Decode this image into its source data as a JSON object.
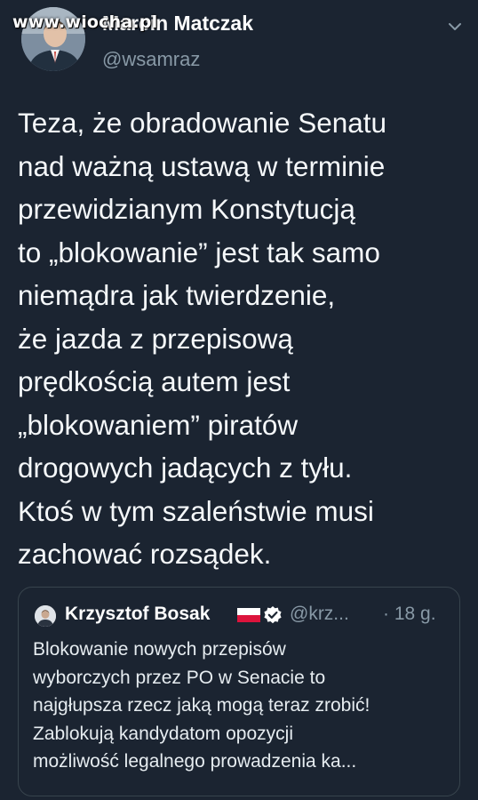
{
  "watermark": "www.wiocha.pl",
  "author": {
    "name": "Marcin Matczak",
    "handle": "@wsamraz"
  },
  "tweet": {
    "lines": [
      "Teza, że obradowanie Senatu",
      "nad ważną ustawą w terminie",
      "przewidzianym Konstytucją",
      "to „blokowanie” jest tak samo",
      "niemądra jak twierdzenie,",
      "że jazda z przepisową",
      "prędkością autem jest",
      "„blokowaniem” piratów",
      "drogowych jadących z tyłu.",
      "Ktoś w tym szaleństwie musi",
      "zachować rozsądek."
    ]
  },
  "quote": {
    "name": "Krzysztof Bosak",
    "handle": "@krz...",
    "time": "· 18 g.",
    "lines": [
      "Blokowanie nowych przepisów",
      "wyborczych przez PO w Senacie to",
      "najgłupsza rzecz jaką mogą teraz zrobić!",
      "Zablokują kandydatom opozycji",
      "możliwość legalnego prowadzenia ka..."
    ]
  },
  "icons": {
    "chevron": "chevron-down-icon",
    "verified": "verified-badge-icon",
    "flag": "poland-flag-icon"
  },
  "colors": {
    "background": "#1b2431",
    "text": "#f5f8fa",
    "secondary": "#8899a6",
    "border": "#38444d",
    "verified": "#ffffff"
  }
}
